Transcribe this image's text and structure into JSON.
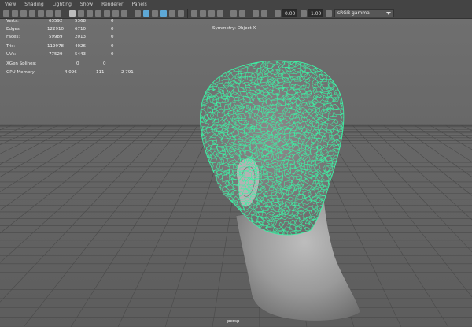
{
  "menu": [
    "View",
    "Shading",
    "Lighting",
    "Show",
    "Renderer",
    "Panels"
  ],
  "toolbar": {
    "exposure": "0.00",
    "gamma": "1.00",
    "color_space": "sRGB gamma",
    "colors": {
      "highlight": "#5ea8d6",
      "icon": "#7a7a7a"
    }
  },
  "hud": {
    "rows": [
      {
        "label": "Verts:",
        "a": "63592",
        "b": "5368",
        "c": "0"
      },
      {
        "label": "Edges:",
        "a": "122910",
        "b": "6710",
        "c": "0"
      },
      {
        "label": "Faces:",
        "a": "59989",
        "b": "2013",
        "c": "0"
      },
      {
        "label": "Tris:",
        "a": "119978",
        "b": "4026",
        "c": "0"
      },
      {
        "label": "UVs:",
        "a": "77529",
        "b": "5443",
        "c": "0"
      }
    ],
    "xgen": {
      "label": "XGen Splines:",
      "a": "0",
      "b": "0"
    },
    "gpu": {
      "label": "GPU Memory:",
      "a": "4 096",
      "b": "111",
      "c": "2 791"
    },
    "symmetry": "Symmetry: Object X"
  },
  "camera": "persp",
  "colors": {
    "wire": "#3df0a4",
    "mesh": "#9a9a9a",
    "grid": "#4a4a4a"
  }
}
